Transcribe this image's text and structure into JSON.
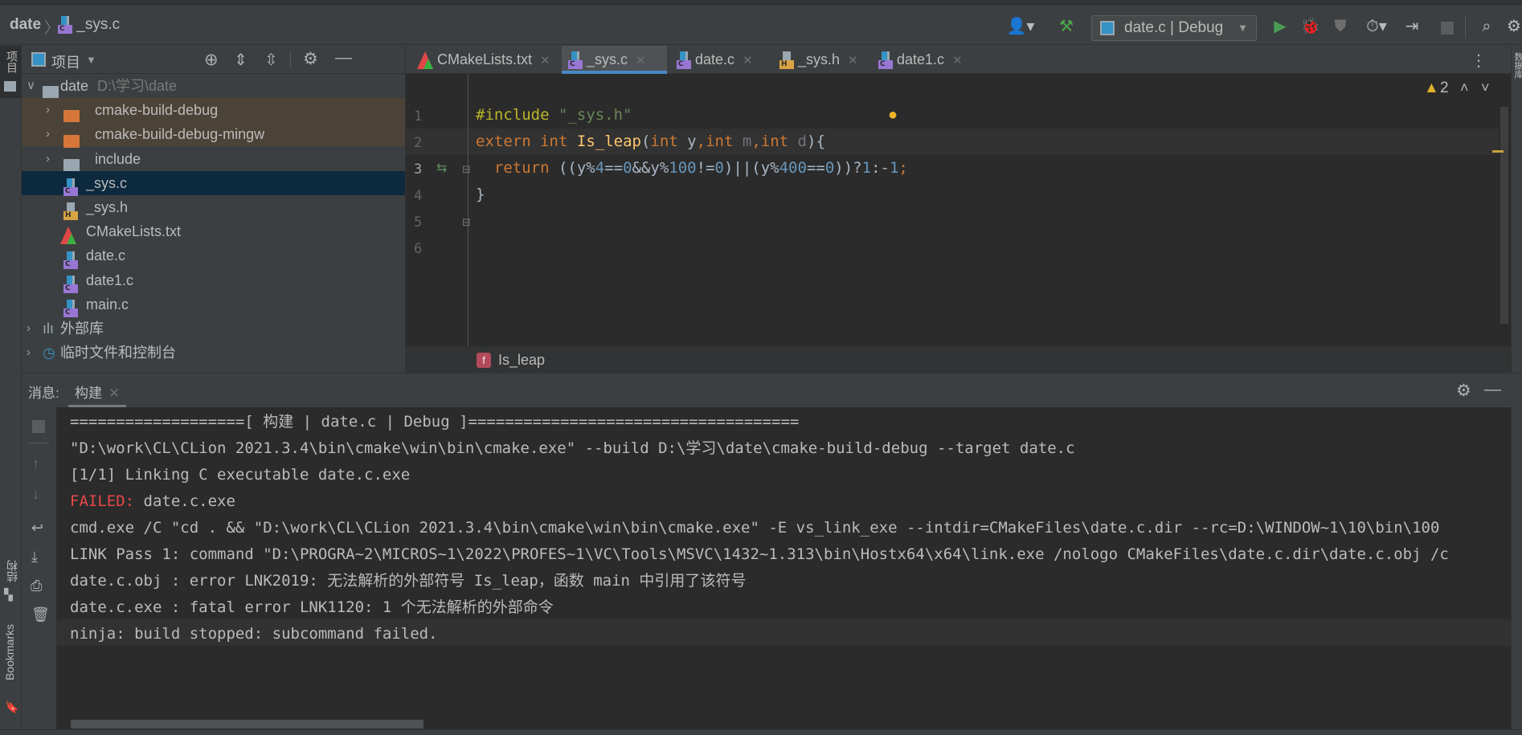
{
  "breadcrumb": {
    "project": "date",
    "file": "_sys.c"
  },
  "toolbar": {
    "run_config": "date.c | Debug",
    "icons": [
      "user-icon",
      "build-hammer-icon",
      "run-icon",
      "debug-bug-icon",
      "coverage-icon",
      "profile-icon",
      "attach-icon",
      "stop-icon",
      "search-icon",
      "settings-icon"
    ]
  },
  "left_strip": {
    "project_label": "项目",
    "structure_label": "结构",
    "bookmarks_label": "Bookmarks"
  },
  "right_strip": {
    "database_label": "数据库"
  },
  "project_panel": {
    "title": "项目",
    "root": {
      "name": "date",
      "path": "D:\\学习\\date"
    },
    "items": [
      {
        "name": "cmake-build-debug",
        "type": "excluded-folder"
      },
      {
        "name": "cmake-build-debug-mingw",
        "type": "excluded-folder"
      },
      {
        "name": "include",
        "type": "folder"
      },
      {
        "name": "_sys.c",
        "type": "c",
        "selected": true
      },
      {
        "name": "_sys.h",
        "type": "h"
      },
      {
        "name": "CMakeLists.txt",
        "type": "cmake"
      },
      {
        "name": "date.c",
        "type": "c"
      },
      {
        "name": "date1.c",
        "type": "c"
      },
      {
        "name": "main.c",
        "type": "c"
      }
    ],
    "external_libs": "外部库",
    "scratches": "临时文件和控制台"
  },
  "tabs": [
    {
      "label": "CMakeLists.txt",
      "type": "cmake"
    },
    {
      "label": "_sys.c",
      "type": "c",
      "active": true
    },
    {
      "label": "date.c",
      "type": "c"
    },
    {
      "label": "_sys.h",
      "type": "h"
    },
    {
      "label": "date1.c",
      "type": "c"
    }
  ],
  "editor": {
    "warnings": "2",
    "lines": [
      [],
      [
        [
          "#include",
          "pp"
        ],
        [
          " ",
          "plain"
        ],
        [
          "\"_sys.h\"",
          "str"
        ]
      ],
      [
        [
          "extern",
          "kw"
        ],
        [
          " ",
          "plain"
        ],
        [
          "int",
          "kw"
        ],
        [
          " ",
          "plain"
        ],
        [
          "Is_leap",
          "fn"
        ],
        [
          "(",
          "plain"
        ],
        [
          "int",
          "kw"
        ],
        [
          " y",
          "plain"
        ],
        [
          ",",
          "kw"
        ],
        [
          "int",
          "kw"
        ],
        [
          " ",
          "plain"
        ],
        [
          "m",
          "unused"
        ],
        [
          ",",
          "kw"
        ],
        [
          "int",
          "kw"
        ],
        [
          " ",
          "plain"
        ],
        [
          "d",
          "unused"
        ],
        [
          "){",
          "plain"
        ]
      ],
      [
        [
          "  ",
          "plain"
        ],
        [
          "return",
          "kw"
        ],
        [
          " ((y%",
          "plain"
        ],
        [
          "4",
          "num"
        ],
        [
          "==",
          "plain"
        ],
        [
          "0",
          "num"
        ],
        [
          "&&y%",
          "plain"
        ],
        [
          "100",
          "num"
        ],
        [
          "!=",
          "plain"
        ],
        [
          "0",
          "num"
        ],
        [
          ")||(y%",
          "plain"
        ],
        [
          "400",
          "num"
        ],
        [
          "==",
          "plain"
        ],
        [
          "0",
          "num"
        ],
        [
          "))?",
          "plain"
        ],
        [
          "1",
          "num"
        ],
        [
          ":-",
          "plain"
        ],
        [
          "1",
          "num"
        ],
        [
          ";",
          "kw"
        ]
      ],
      [
        [
          "}",
          "plain"
        ]
      ],
      []
    ],
    "current_line": 3,
    "breadcrumb_function": "Is_leap"
  },
  "bottom_panel": {
    "label": "消息:",
    "tab": "构建",
    "lines": [
      {
        "text": "===================[ 构建 | date.c | Debug ]===================================="
      },
      {
        "text": "\"D:\\work\\CL\\CLion 2021.3.4\\bin\\cmake\\win\\bin\\cmake.exe\" --build D:\\学习\\date\\cmake-build-debug --target date.c"
      },
      {
        "text": "[1/1] Linking C executable date.c.exe"
      },
      {
        "prefix": "FAILED:",
        "text": " date.c.exe"
      },
      {
        "text": "cmd.exe /C \"cd . && \"D:\\work\\CL\\CLion 2021.3.4\\bin\\cmake\\win\\bin\\cmake.exe\" -E vs_link_exe --intdir=CMakeFiles\\date.c.dir --rc=D:\\WINDOW~1\\10\\bin\\100"
      },
      {
        "text": "LINK Pass 1: command \"D:\\PROGRA~2\\MICROS~1\\2022\\PROFES~1\\VC\\Tools\\MSVC\\1432~1.313\\bin\\Hostx64\\x64\\link.exe /nologo CMakeFiles\\date.c.dir\\date.c.obj /c"
      },
      {
        "text": "date.c.obj : error LNK2019: 无法解析的外部符号 Is_leap，函数 main 中引用了该符号"
      },
      {
        "text": "date.c.exe : fatal error LNK1120: 1 个无法解析的外部命令"
      },
      {
        "text": "ninja: build stopped: subcommand failed."
      }
    ]
  }
}
